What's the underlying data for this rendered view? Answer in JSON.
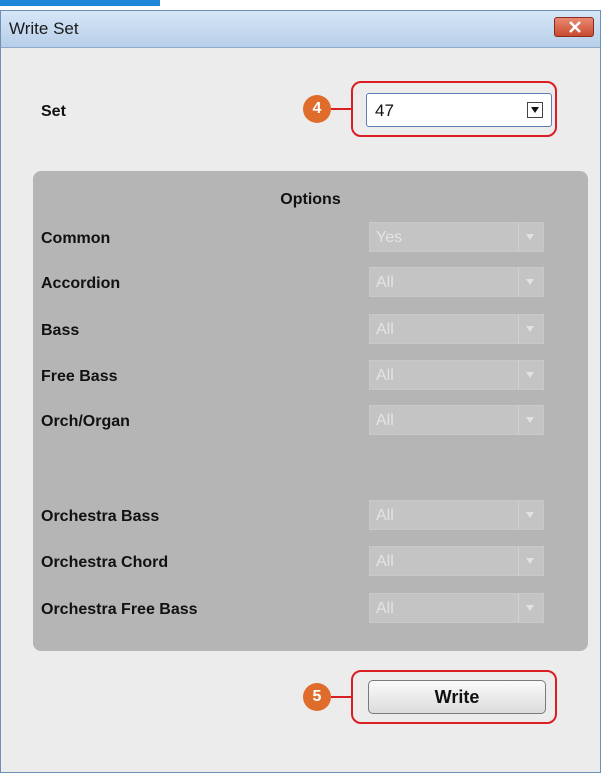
{
  "window": {
    "title": "Write Set"
  },
  "set": {
    "label": "Set",
    "value": "47"
  },
  "callouts": {
    "set": "4",
    "write": "5"
  },
  "options": {
    "title": "Options",
    "rows": [
      {
        "label": "Common",
        "value": "Yes"
      },
      {
        "label": "Accordion",
        "value": "All"
      },
      {
        "label": "Bass",
        "value": "All"
      },
      {
        "label": "Free Bass",
        "value": "All"
      },
      {
        "label": "Orch/Organ",
        "value": "All"
      },
      {
        "label": "Orchestra Bass",
        "value": "All"
      },
      {
        "label": "Orchestra Chord",
        "value": "All"
      },
      {
        "label": "Orchestra Free Bass",
        "value": "All"
      }
    ]
  },
  "buttons": {
    "write": "Write"
  },
  "colors": {
    "callout_ring": "#d91e24",
    "callout_badge": "#e06c2c",
    "panel": "#b5b5b5"
  }
}
